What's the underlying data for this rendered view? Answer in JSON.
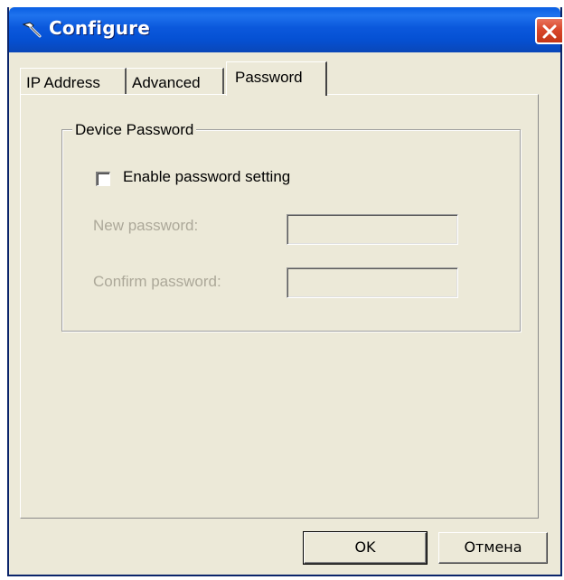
{
  "window": {
    "title": "Configure",
    "icon": "hammer-icon",
    "close_icon": "close-icon",
    "colors": {
      "titlebar": "#0551d4",
      "face": "#ece9d8",
      "close": "#d9472b",
      "disabled_text": "#aca899"
    }
  },
  "tabs": [
    {
      "label": "IP Address",
      "selected": false
    },
    {
      "label": "Advanced",
      "selected": false
    },
    {
      "label": "Password",
      "selected": true
    }
  ],
  "group": {
    "legend": "Device Password",
    "checkbox": {
      "label": "Enable password setting",
      "checked": false
    },
    "new_password": {
      "label": "New password:",
      "value": "",
      "disabled": true
    },
    "confirm_password": {
      "label": "Confirm password:",
      "value": "",
      "disabled": true
    }
  },
  "buttons": {
    "ok": "OK",
    "cancel": "Отмена"
  }
}
